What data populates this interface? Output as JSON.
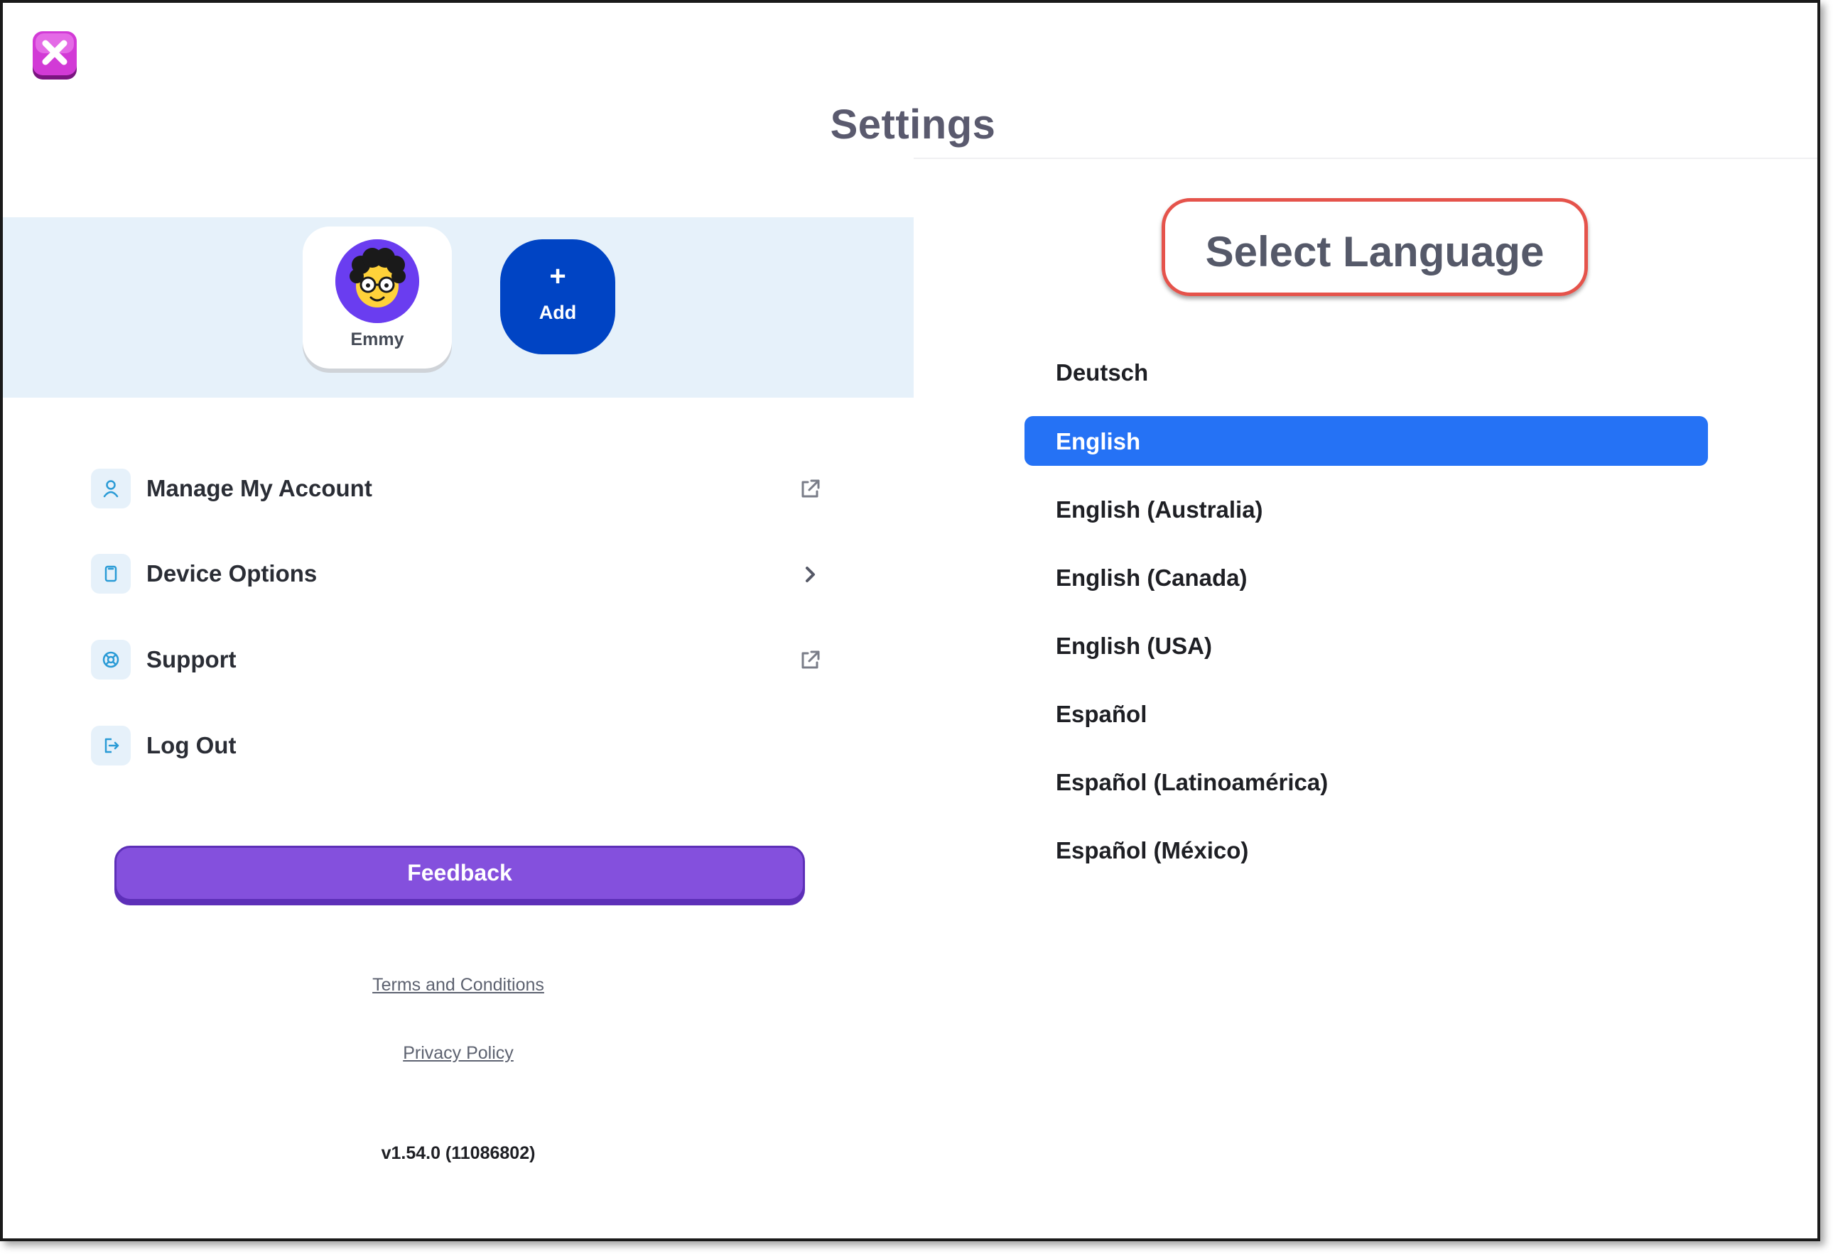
{
  "window": {
    "title": "Settings"
  },
  "profiles": {
    "items": [
      {
        "name": "Emmy",
        "avatar_icon": "child-avatar-icon"
      }
    ],
    "add_label": "Add",
    "add_symbol": "+"
  },
  "menu": {
    "items": [
      {
        "label": "Manage My Account",
        "icon": "person-icon",
        "trail": "external-link-icon"
      },
      {
        "label": "Device Options",
        "icon": "tablet-icon",
        "trail": "chevron-right-icon"
      },
      {
        "label": "Support",
        "icon": "lifebuoy-icon",
        "trail": "external-link-icon"
      },
      {
        "label": "Log Out",
        "icon": "logout-icon",
        "trail": ""
      }
    ]
  },
  "feedback_label": "Feedback",
  "footer": {
    "terms": "Terms and Conditions",
    "privacy": "Privacy Policy",
    "version": "v1.54.0 (11086802)"
  },
  "language": {
    "title": "Select Language",
    "selected": "English",
    "options": [
      "Deutsch",
      "English",
      "English (Australia)",
      "English (Canada)",
      "English (USA)",
      "Español",
      "Español (Latinoamérica)",
      "Español (México)"
    ]
  },
  "colors": {
    "accent_blue": "#2572f5",
    "add_button": "#0044c4",
    "feedback_purple": "#8450dd",
    "close_magenta": "#c026c8",
    "highlight_red": "#e5534b"
  }
}
